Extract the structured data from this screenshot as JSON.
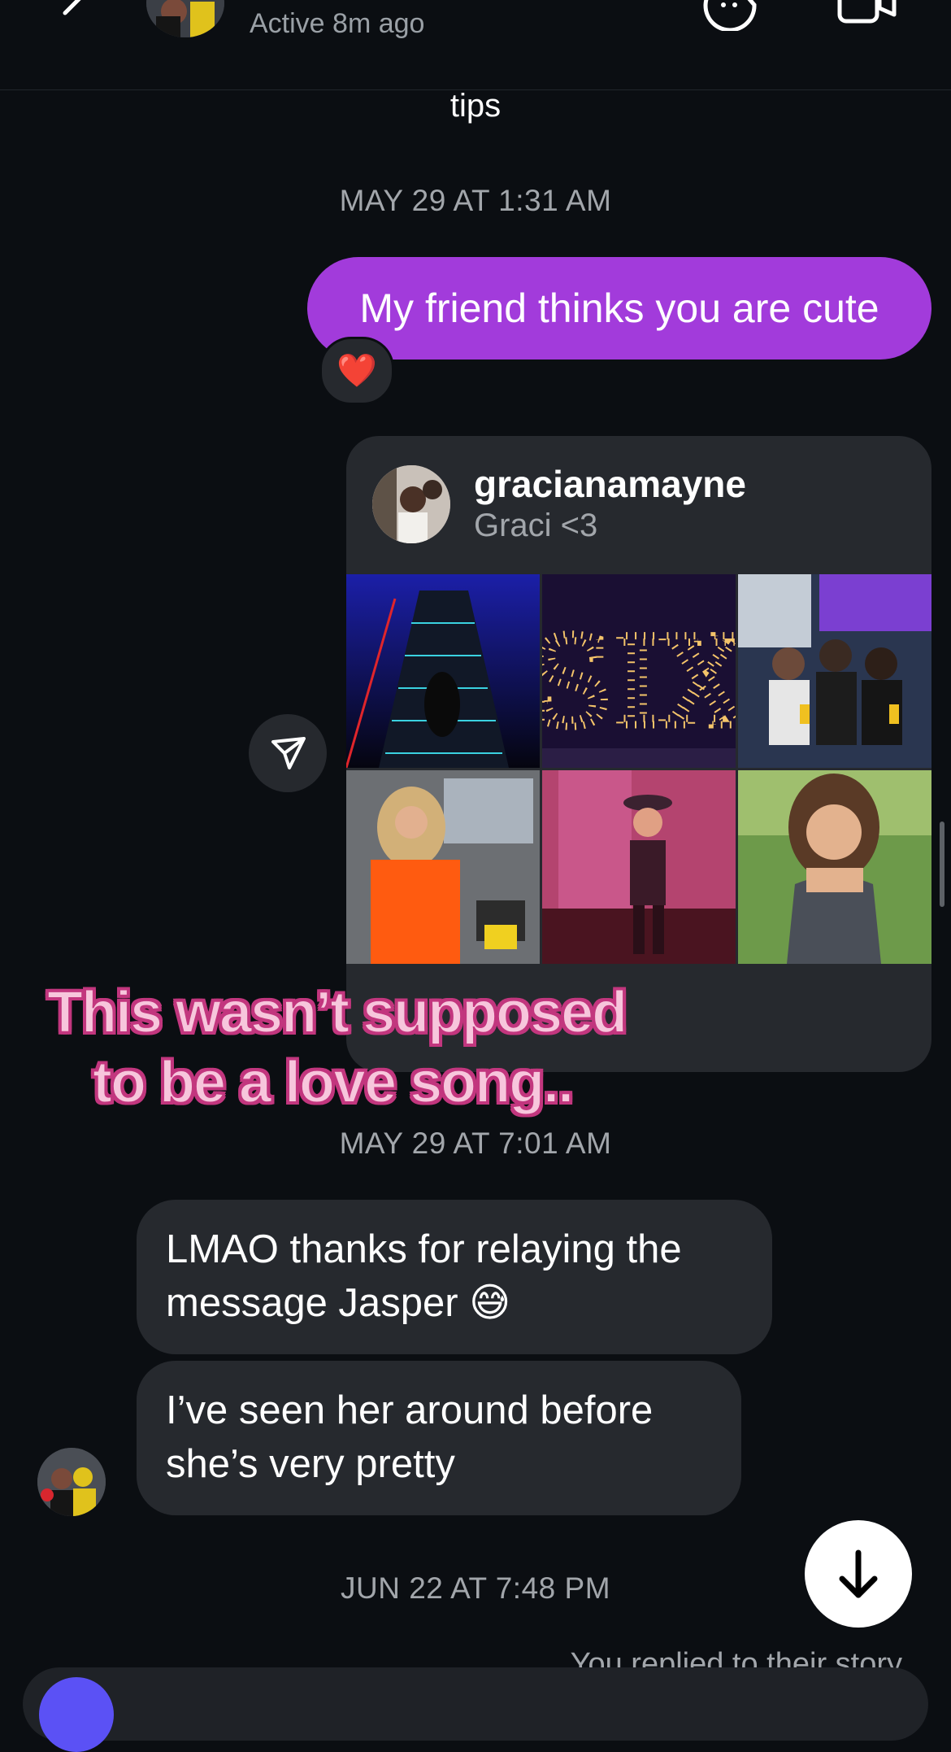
{
  "header": {
    "status": "Active 8m ago"
  },
  "thread": {
    "tips_text": "tips",
    "timestamp_1": "MAY 29 AT 1:31 AM",
    "outgoing_message": "My friend thinks you are cute",
    "reaction_emoji": "❤️",
    "shared_post": {
      "username": "gracianamayne",
      "subtitle": "Graci <3"
    },
    "overlay_caption": {
      "line1": "This wasn’t supposed",
      "line2": "to be a love song.."
    },
    "timestamp_2": "MAY 29 AT 7:01 AM",
    "incoming_1": {
      "line1": "LMAO thanks for relaying the",
      "line2": "message Jasper 😅"
    },
    "incoming_2": {
      "line1": "I’ve seen her around before",
      "line2": "she’s very pretty"
    },
    "timestamp_3": "JUN 22 AT 7:48 PM",
    "story_reply": "You replied to their story"
  },
  "icons": {
    "back": "chevron-left-icon",
    "sticker": "sticker-icon",
    "video": "video-camera-icon",
    "share": "paper-plane-icon",
    "scroll_down": "arrow-down-icon"
  },
  "colors": {
    "background": "#0b0e12",
    "outgoing_bubble": "#a23bdb",
    "incoming_bubble": "#26292e",
    "overlay_fill": "#f7c6dc",
    "overlay_outline": "#c2367e"
  }
}
